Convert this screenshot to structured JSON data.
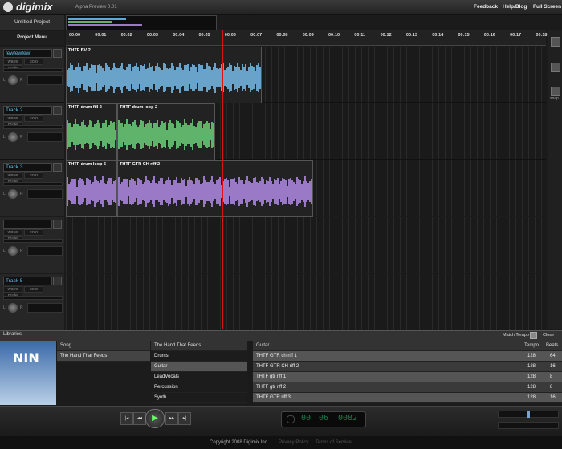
{
  "app": {
    "logo": "digimix",
    "version": "Alpha Preview 0.01"
  },
  "topnav": {
    "feedback": "Feedback",
    "help": "Help/Blog",
    "fullscreen": "Full Screen"
  },
  "project": {
    "title": "Untitled Project",
    "menu": "Project Menu"
  },
  "ruler": [
    "00:00",
    "00:01",
    "00:02",
    "00:03",
    "00:04",
    "00:05",
    "00:06",
    "00:07",
    "00:08",
    "00:09",
    "00:10",
    "00:11",
    "00:12",
    "00:13",
    "00:14",
    "00:15",
    "00:16",
    "00:17",
    "00:18"
  ],
  "tracks": [
    {
      "name": "fewfewfew",
      "wave": "wave",
      "solo": "solo",
      "mute": "mute",
      "clips": [
        {
          "title": "THTF BV 2"
        }
      ],
      "color": "#6aa3c9"
    },
    {
      "name": "Track 2",
      "wave": "wave",
      "solo": "solo",
      "mute": "mute",
      "clips": [
        {
          "title": "THTF drum fill 2"
        },
        {
          "title": "THTF drum loop 2"
        }
      ],
      "color": "#5fb36a"
    },
    {
      "name": "Track 3",
      "wave": "wave",
      "solo": "solo",
      "mute": "mute",
      "clips": [
        {
          "title": "THTF drum loop 5"
        },
        {
          "title": "THTF GTR CH riff 2"
        }
      ],
      "color": "#9a7ac7"
    },
    {
      "name": "",
      "wave": "wave",
      "solo": "solo",
      "mute": "mute",
      "clips": [],
      "color": "#666"
    },
    {
      "name": "Track 5",
      "wave": "wave",
      "solo": "solo",
      "mute": "mute",
      "clips": [],
      "color": "#666"
    }
  ],
  "knob_labels": {
    "left": "L",
    "right": "R"
  },
  "right_icons": [
    "record-icon",
    "note-icon",
    "snap-icon"
  ],
  "snap_label": "snap",
  "libraries": {
    "title": "Libraries",
    "match_tempo": "Match Tempo",
    "close": "Close",
    "song_col": {
      "header": "Song",
      "items": [
        "The Hand That Feeds"
      ]
    },
    "category_col": {
      "header": "The Hand That Feeds",
      "items": [
        "Drums",
        "Guitar",
        "LeadVocals",
        "Percussion",
        "Synth"
      ],
      "selected": "Guitar"
    },
    "clips_col": {
      "header": "Guitar",
      "tempo_header": "Tempo",
      "beats_header": "Beats",
      "rows": [
        {
          "name": "THTF GTR ch riff 1",
          "tempo": "128",
          "beats": "64"
        },
        {
          "name": "THTF GTR CH riff 2",
          "tempo": "128",
          "beats": "16"
        },
        {
          "name": "THTF gtr riff 1",
          "tempo": "128",
          "beats": "8"
        },
        {
          "name": "THTF gtr riff 2",
          "tempo": "128",
          "beats": "8"
        },
        {
          "name": "THTF GTR riff 3",
          "tempo": "128",
          "beats": "16"
        }
      ]
    }
  },
  "transport": {
    "minutes": "00",
    "seconds": "06",
    "millis": "0082",
    "play_icon": "play-icon"
  },
  "footer": {
    "copyright": "Copyright 2008 Digimix Inc.",
    "privacy": "Privacy Policy",
    "terms": "Terms of Service"
  }
}
